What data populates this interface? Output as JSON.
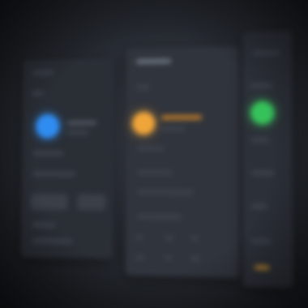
{
  "screen": {
    "colors": {
      "background": "#1b1d22",
      "panel": "#2e323a",
      "blue_status": "#2f8cf0",
      "orange_status": "#f0a53a",
      "green_status": "#36c25a"
    },
    "panels": [
      {
        "id": "left",
        "status_icon": "blue-status-dot-icon"
      },
      {
        "id": "center",
        "status_icon": "orange-status-dot-icon"
      },
      {
        "id": "right",
        "status_icon": "green-status-dot-icon"
      }
    ]
  }
}
